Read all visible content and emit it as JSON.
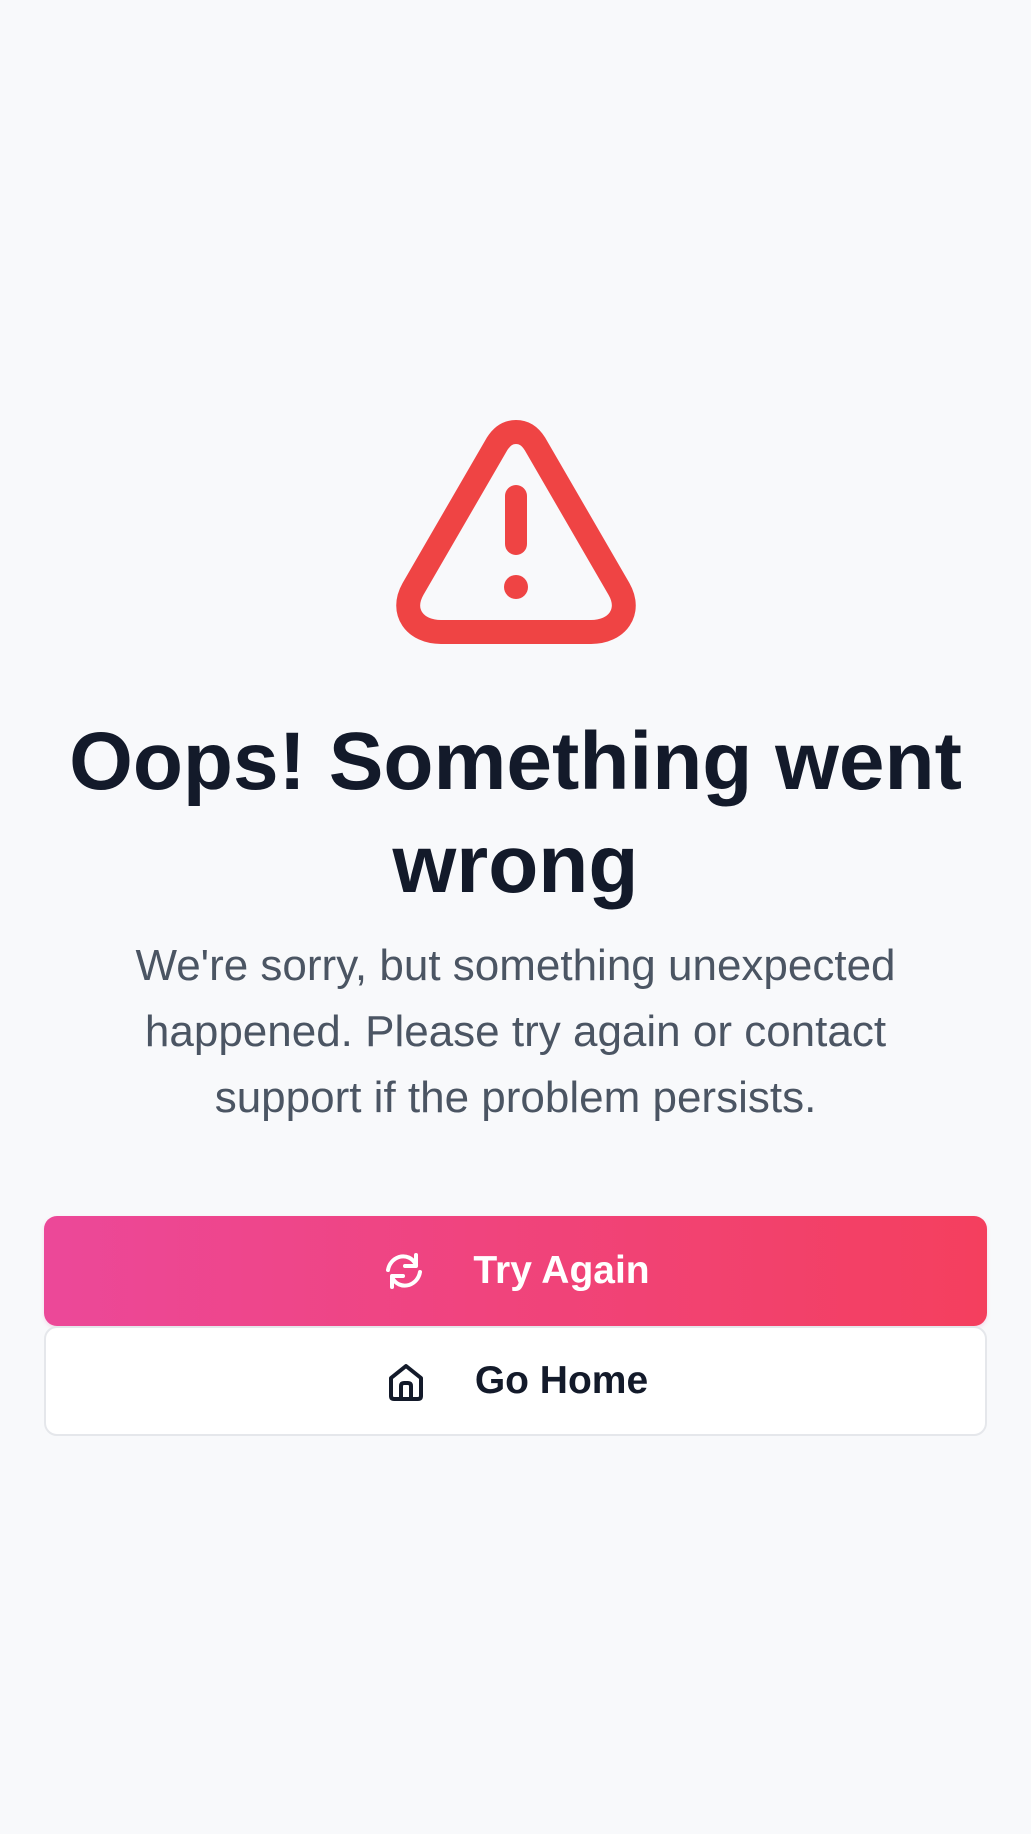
{
  "error_page": {
    "title": "Oops! Something went wrong",
    "message": "We're sorry, but something unexpected happened. Please try again or contact support if the problem persists.",
    "icon": "warning-triangle-icon",
    "accent_color": "#ef4444"
  },
  "actions": {
    "try_again": {
      "label": "Try Again",
      "icon": "refresh-icon",
      "gradient_start": "#ec4899",
      "gradient_end": "#f43f5e"
    },
    "go_home": {
      "label": "Go Home",
      "icon": "home-icon"
    }
  }
}
